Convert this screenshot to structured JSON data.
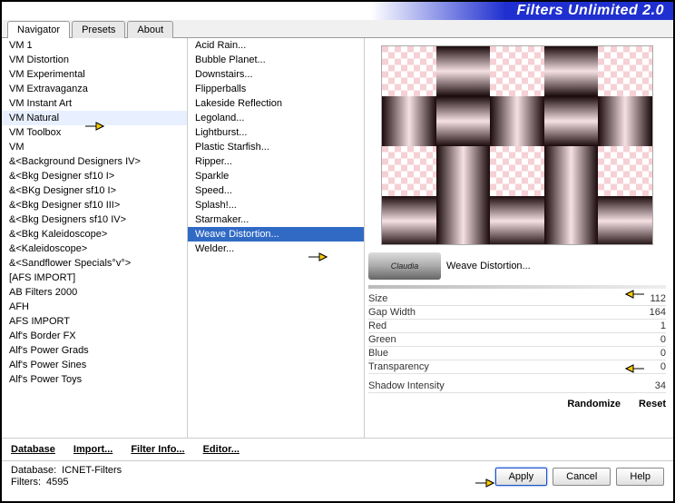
{
  "app": {
    "title": "Filters Unlimited 2.0"
  },
  "tabs": [
    "Navigator",
    "Presets",
    "About"
  ],
  "categories": [
    "VM 1",
    "VM Distortion",
    "VM Experimental",
    "VM Extravaganza",
    "VM Instant Art",
    "VM Natural",
    "VM Toolbox",
    "VM",
    "&<Background Designers IV>",
    "&<Bkg Designer sf10 I>",
    "&<BKg Designer sf10 I>",
    "&<Bkg Designer sf10 III>",
    "&<Bkg Designers sf10 IV>",
    "&<Bkg Kaleidoscope>",
    "&<Kaleidoscope>",
    "&<Sandflower Specials°v°>",
    "[AFS IMPORT]",
    "AB Filters 2000",
    "AFH",
    "AFS IMPORT",
    "Alf's Border FX",
    "Alf's Power Grads",
    "Alf's Power Sines",
    "Alf's Power Toys"
  ],
  "filters": [
    "Acid Rain...",
    "Bubble Planet...",
    "Downstairs...",
    "Flipperballs",
    "Lakeside Reflection",
    "Legoland...",
    "Lightburst...",
    "Plastic Starfish...",
    "Ripper...",
    "Sparkle",
    "Speed...",
    "Splash!...",
    "Starmaker...",
    "Weave Distortion...",
    "Welder..."
  ],
  "selected_filter_index": 13,
  "current_filter": "Weave Distortion...",
  "watermark": "Claudia",
  "params": [
    {
      "label": "Size",
      "value": 112
    },
    {
      "label": "Gap Width",
      "value": 164
    },
    {
      "label": "Red",
      "value": 1
    },
    {
      "label": "Green",
      "value": 0
    },
    {
      "label": "Blue",
      "value": 0
    },
    {
      "label": "Transparency",
      "value": 0
    }
  ],
  "params2": [
    {
      "label": "Shadow Intensity",
      "value": 34
    }
  ],
  "actions": {
    "database": "Database",
    "import": "Import...",
    "filter_info": "Filter Info...",
    "editor": "Editor...",
    "randomize": "Randomize",
    "reset": "Reset"
  },
  "status": {
    "db_label": "Database:",
    "db_value": "ICNET-Filters",
    "filters_label": "Filters:",
    "filters_value": "4595"
  },
  "buttons": {
    "apply": "Apply",
    "cancel": "Cancel",
    "help": "Help"
  }
}
